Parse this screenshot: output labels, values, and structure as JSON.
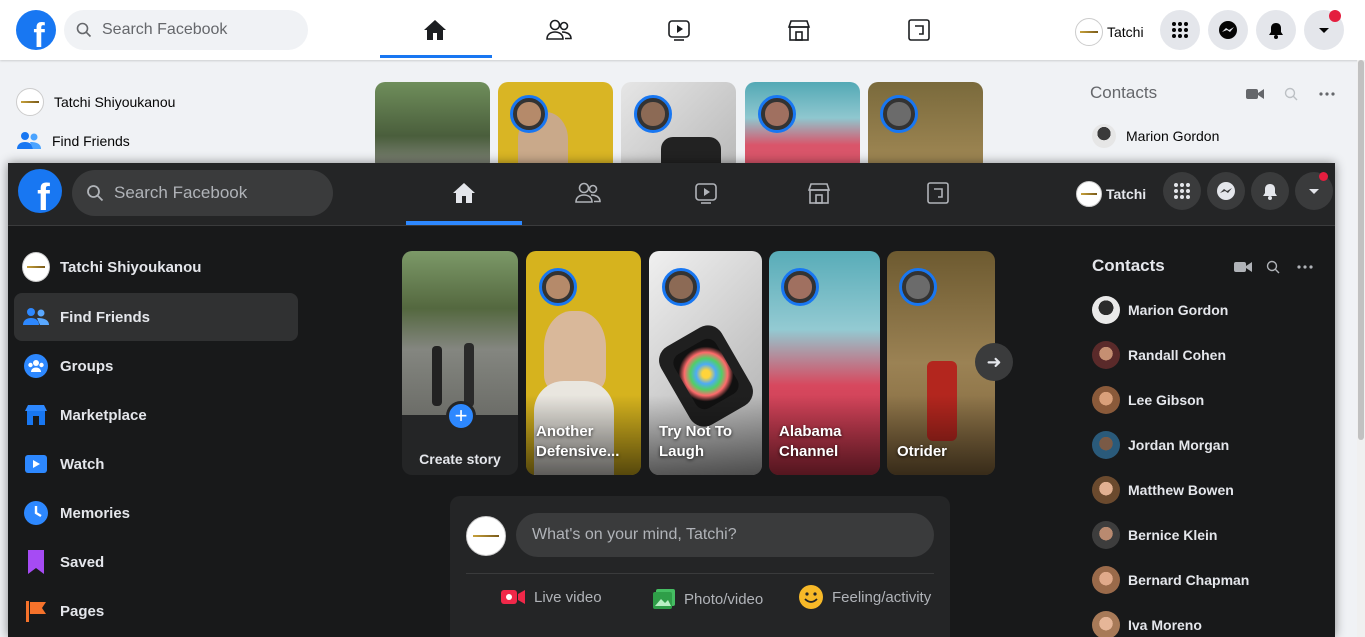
{
  "colors": {
    "brand": "#1877f2",
    "dark_bg": "#18191a",
    "dark_surface": "#242526",
    "notification": "#e41e3f"
  },
  "light": {
    "search": {
      "placeholder": "Search Facebook"
    },
    "user": {
      "name": "Tatchi"
    },
    "sidebar": [
      {
        "label": "Tatchi Shiyoukanou",
        "icon": "avatar"
      },
      {
        "label": "Find Friends",
        "icon": "friends-icon"
      }
    ],
    "contacts_title": "Contacts",
    "contacts": [
      "Marion Gordon"
    ]
  },
  "dark": {
    "search": {
      "placeholder": "Search Facebook"
    },
    "user": {
      "name": "Tatchi"
    },
    "sidebar": [
      {
        "label": "Tatchi Shiyoukanou",
        "icon": "avatar"
      },
      {
        "label": "Find Friends",
        "icon": "friends-icon"
      },
      {
        "label": "Groups",
        "icon": "groups-icon"
      },
      {
        "label": "Marketplace",
        "icon": "marketplace-icon"
      },
      {
        "label": "Watch",
        "icon": "watch-icon"
      },
      {
        "label": "Memories",
        "icon": "memories-icon"
      },
      {
        "label": "Saved",
        "icon": "saved-icon"
      },
      {
        "label": "Pages",
        "icon": "pages-icon"
      }
    ],
    "stories": [
      {
        "label": "Create story"
      },
      {
        "label": "Another Defensive..."
      },
      {
        "label": "Try Not To Laugh"
      },
      {
        "label": "Alabama Channel"
      },
      {
        "label": "Otrider"
      }
    ],
    "composer": {
      "placeholder": "What's on your mind, Tatchi?",
      "actions": [
        "Live video",
        "Photo/video",
        "Feeling/activity"
      ]
    },
    "contacts_title": "Contacts",
    "contacts": [
      "Marion Gordon",
      "Randall Cohen",
      "Lee Gibson",
      "Jordan Morgan",
      "Matthew Bowen",
      "Bernice Klein",
      "Bernard Chapman",
      "Iva Moreno"
    ]
  }
}
